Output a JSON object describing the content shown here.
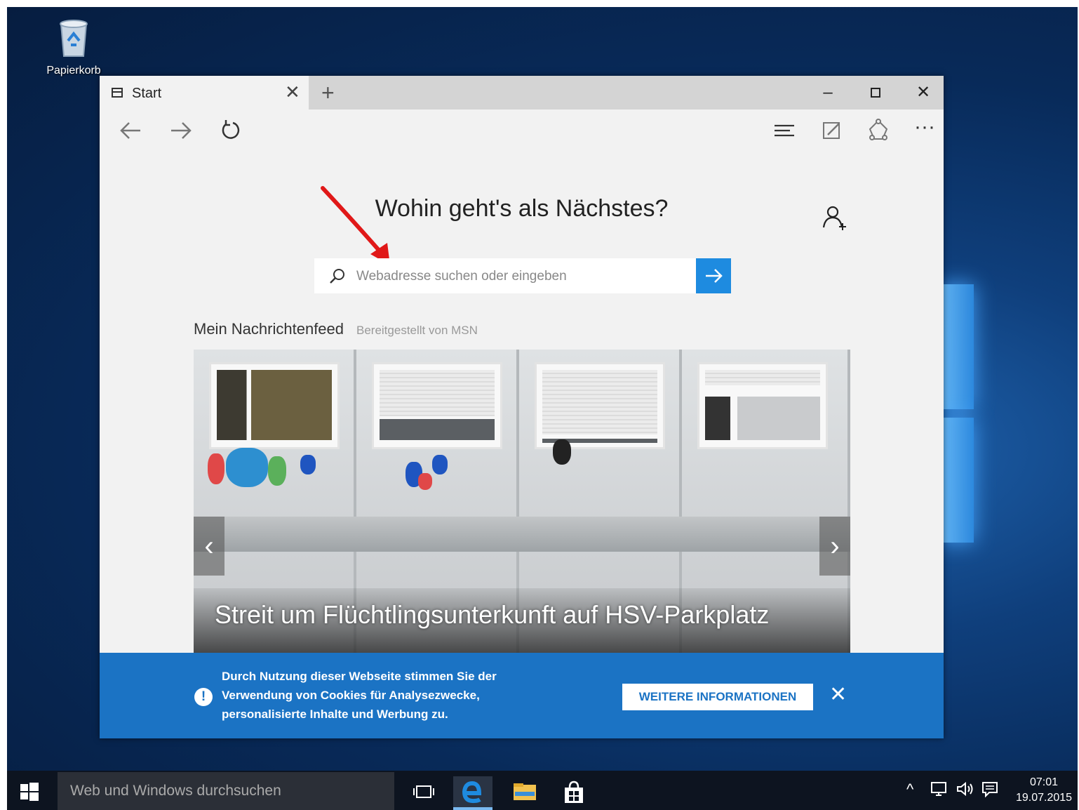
{
  "desktop": {
    "recycle_bin_label": "Papierkorb"
  },
  "browser": {
    "tab_title": "Start",
    "heading": "Wohin geht's als Nächstes?",
    "search_placeholder": "Webadresse suchen oder eingeben",
    "feed": {
      "title": "Mein Nachrichtenfeed",
      "source": "Bereitgestellt von MSN",
      "headline": "Streit um Flüchtlingsunterkunft auf HSV-Parkplatz"
    },
    "cookie_banner": {
      "message": "Durch Nutzung dieser Webseite stimmen Sie der Verwendung von Cookies für Analysezwecke, personalisierte Inhalte und Werbung zu.",
      "button_label": "WEITERE INFORMATIONEN"
    }
  },
  "taskbar": {
    "search_placeholder": "Web und Windows durchsuchen",
    "time": "07:01",
    "date": "19.07.2015"
  },
  "colors": {
    "accent": "#1e8be0",
    "banner": "#1b73c4",
    "annotation_arrow": "#e01818"
  },
  "icons": [
    "recycle-bin-icon",
    "tab-page-icon",
    "close-icon",
    "plus-icon",
    "minimize-icon",
    "maximize-icon",
    "back-arrow-icon",
    "forward-arrow-icon",
    "refresh-icon",
    "hub-icon",
    "web-note-icon",
    "share-icon",
    "more-icon",
    "add-person-icon",
    "search-icon",
    "go-arrow-icon",
    "info-icon",
    "windows-start-icon",
    "task-view-icon",
    "edge-icon",
    "file-explorer-icon",
    "store-icon",
    "chevron-up-icon",
    "network-icon",
    "volume-icon",
    "action-center-icon"
  ]
}
